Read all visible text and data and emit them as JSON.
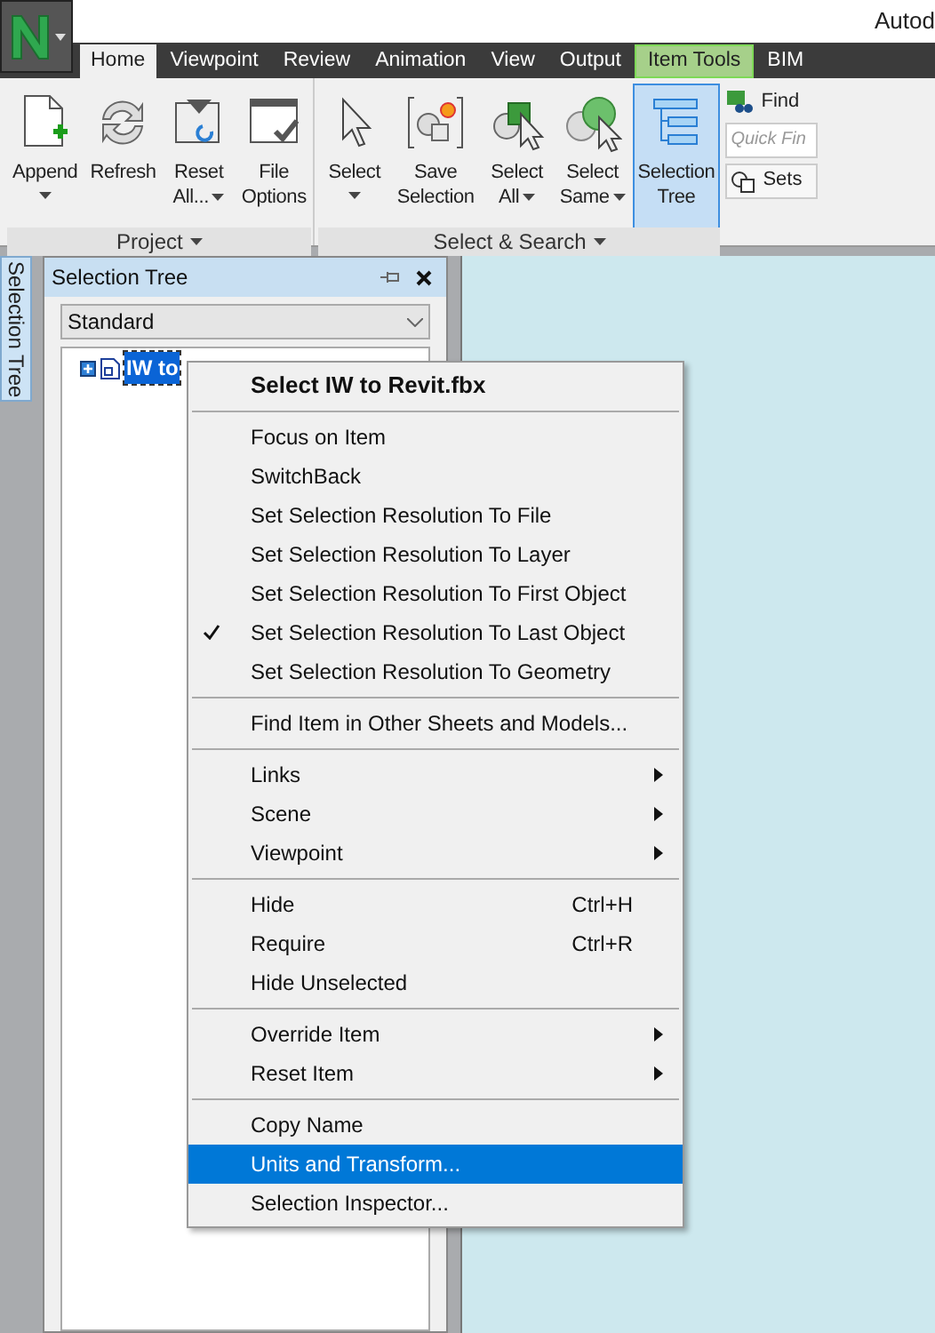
{
  "window": {
    "title": "Autod"
  },
  "tabs": [
    {
      "label": "Home",
      "selected": true,
      "kind": "normal"
    },
    {
      "label": "Viewpoint",
      "selected": false,
      "kind": "normal"
    },
    {
      "label": "Review",
      "selected": false,
      "kind": "normal"
    },
    {
      "label": "Animation",
      "selected": false,
      "kind": "normal"
    },
    {
      "label": "View",
      "selected": false,
      "kind": "normal"
    },
    {
      "label": "Output",
      "selected": false,
      "kind": "normal"
    },
    {
      "label": "Item Tools",
      "selected": false,
      "kind": "contextual"
    },
    {
      "label": "BIM",
      "selected": false,
      "kind": "normal"
    }
  ],
  "ribbon": {
    "groups": [
      {
        "title": "Project",
        "buttons": [
          {
            "lines": [
              "Append"
            ],
            "caret": true,
            "selected": false
          },
          {
            "lines": [
              "Refresh"
            ],
            "caret": false,
            "selected": false
          },
          {
            "lines": [
              "Reset",
              "All..."
            ],
            "caret": true,
            "selected": false
          },
          {
            "lines": [
              "File",
              "Options"
            ],
            "caret": false,
            "selected": false
          }
        ]
      },
      {
        "title": "Select & Search",
        "buttons": [
          {
            "lines": [
              "Select"
            ],
            "caret": true,
            "selected": false
          },
          {
            "lines": [
              "Save",
              "Selection"
            ],
            "caret": false,
            "selected": false
          },
          {
            "lines": [
              "Select",
              "All"
            ],
            "caret": true,
            "selected": false
          },
          {
            "lines": [
              "Select",
              "Same"
            ],
            "caret": true,
            "selected": false
          },
          {
            "lines": [
              "Selection",
              "Tree"
            ],
            "caret": false,
            "selected": true
          }
        ]
      }
    ],
    "find": {
      "label": "Find",
      "placeholder": "Quick Fin",
      "sets": "Sets"
    }
  },
  "side_tab": {
    "label": "Selection Tree"
  },
  "panel": {
    "title": "Selection Tree",
    "mode": "Standard",
    "tree": [
      {
        "label": "IW to",
        "selected": true,
        "expanded": false
      }
    ]
  },
  "context_menu": {
    "groups": [
      [
        {
          "label": "Select IW to Revit.fbx",
          "kind": "header",
          "checked": false,
          "selected": false
        }
      ],
      [
        {
          "label": "Focus on Item",
          "kind": "item",
          "checked": false,
          "selected": false
        },
        {
          "label": "SwitchBack",
          "kind": "item",
          "checked": false,
          "selected": false
        },
        {
          "label": "Set Selection Resolution To File",
          "kind": "item",
          "checked": false,
          "selected": false
        },
        {
          "label": "Set Selection Resolution To Layer",
          "kind": "item",
          "checked": false,
          "selected": false
        },
        {
          "label": "Set Selection Resolution To First Object",
          "kind": "item",
          "checked": false,
          "selected": false
        },
        {
          "label": "Set Selection Resolution To Last Object",
          "kind": "item",
          "checked": true,
          "selected": false
        },
        {
          "label": "Set Selection Resolution To Geometry",
          "kind": "item",
          "checked": false,
          "selected": false
        }
      ],
      [
        {
          "label": "Find Item in Other Sheets and Models...",
          "kind": "item",
          "checked": false,
          "selected": false
        }
      ],
      [
        {
          "label": "Links",
          "kind": "submenu",
          "checked": false,
          "selected": false
        },
        {
          "label": "Scene",
          "kind": "submenu",
          "checked": false,
          "selected": false
        },
        {
          "label": "Viewpoint",
          "kind": "submenu",
          "checked": false,
          "selected": false
        }
      ],
      [
        {
          "label": "Hide",
          "kind": "item",
          "shortcut": "Ctrl+H",
          "checked": false,
          "selected": false
        },
        {
          "label": "Require",
          "kind": "item",
          "shortcut": "Ctrl+R",
          "checked": false,
          "selected": false
        },
        {
          "label": "Hide Unselected",
          "kind": "item",
          "checked": false,
          "selected": false
        }
      ],
      [
        {
          "label": "Override Item",
          "kind": "submenu",
          "checked": false,
          "selected": false
        },
        {
          "label": "Reset Item",
          "kind": "submenu",
          "checked": false,
          "selected": false
        }
      ],
      [
        {
          "label": "Copy Name",
          "kind": "item",
          "checked": false,
          "selected": false
        },
        {
          "label": "Units and Transform...",
          "kind": "item",
          "checked": false,
          "selected": true
        },
        {
          "label": "Selection Inspector...",
          "kind": "item",
          "checked": false,
          "selected": false
        }
      ]
    ]
  }
}
